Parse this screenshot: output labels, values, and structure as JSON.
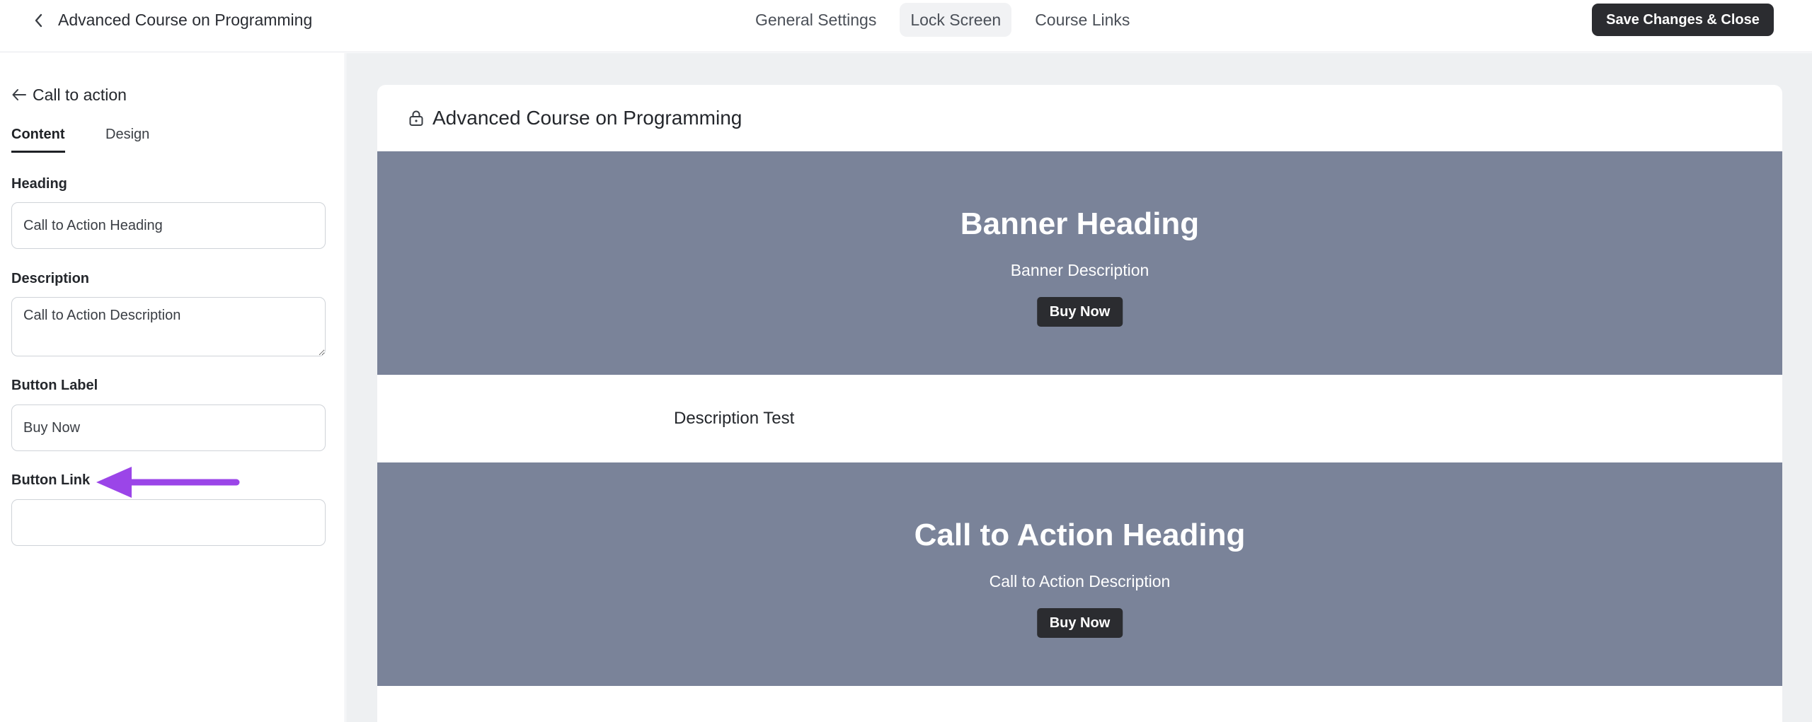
{
  "header": {
    "title": "Advanced Course on Programming",
    "tabs": [
      {
        "label": "General Settings",
        "active": false
      },
      {
        "label": "Lock Screen",
        "active": true
      },
      {
        "label": "Course Links",
        "active": false
      }
    ],
    "save_label": "Save Changes & Close"
  },
  "panel": {
    "back_label": "Call to action",
    "tabs": [
      {
        "label": "Content",
        "active": true
      },
      {
        "label": "Design",
        "active": false
      }
    ],
    "fields": {
      "heading": {
        "label": "Heading",
        "value": "Call to Action Heading"
      },
      "description": {
        "label": "Description",
        "value": "Call to Action Description"
      },
      "button_label": {
        "label": "Button Label",
        "value": "Buy Now"
      },
      "button_link": {
        "label": "Button Link",
        "value": ""
      }
    },
    "annotation": {
      "icon": "arrow-left-icon",
      "color": "#9b45e8"
    }
  },
  "preview": {
    "title": "Advanced Course on Programming",
    "banner": {
      "heading": "Banner Heading",
      "description": "Banner Description",
      "button": "Buy Now",
      "color": "#7a8399"
    },
    "description_text": "Description Test",
    "cta": {
      "heading": "Call to Action Heading",
      "description": "Call to Action Description",
      "button": "Buy Now",
      "color": "#7a8399"
    }
  },
  "colors": {
    "primary_button": "#2b2c30",
    "canvas_bg": "#eef0f2",
    "accent_arrow": "#9b45e8"
  }
}
